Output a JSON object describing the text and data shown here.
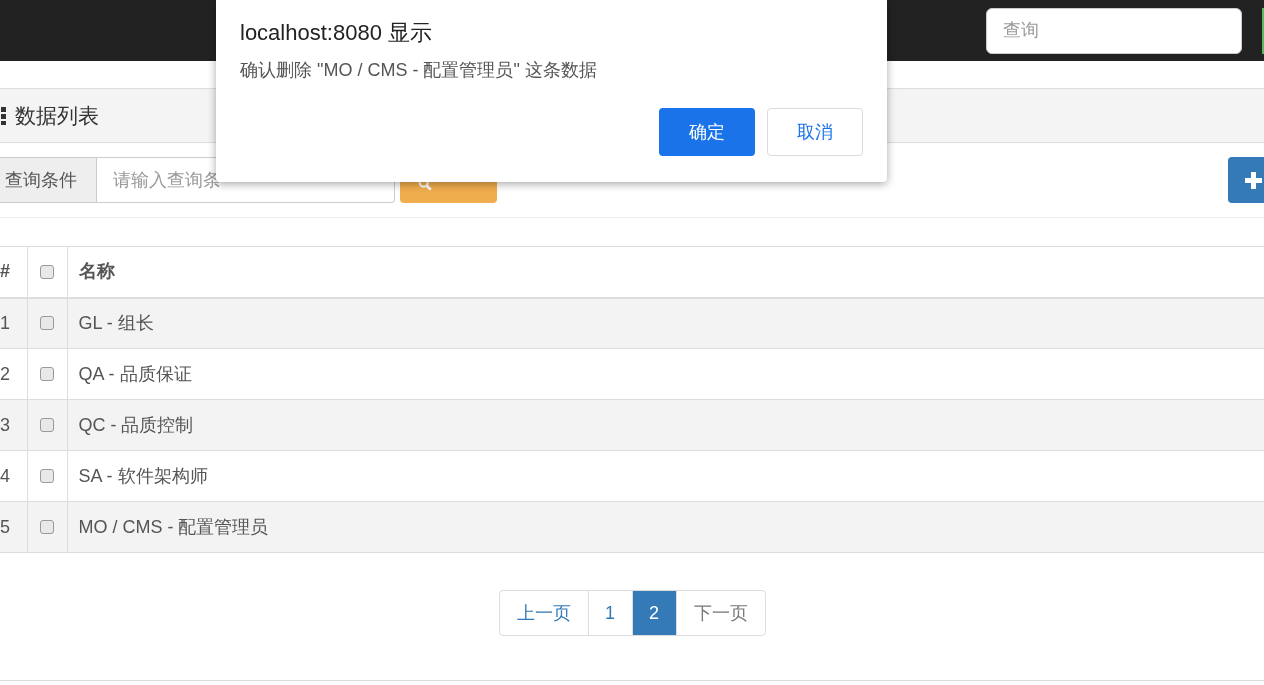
{
  "navbar": {
    "search_placeholder": "查询"
  },
  "panel": {
    "title": "数据列表"
  },
  "query": {
    "label": "查询条件",
    "placeholder": "请输入查询条"
  },
  "table": {
    "columns": [
      "#",
      "名称"
    ],
    "header_checked": false,
    "rows": [
      {
        "index": "1",
        "name": "GL - 组长",
        "checked": false
      },
      {
        "index": "2",
        "name": "QA - 品质保证",
        "checked": false
      },
      {
        "index": "3",
        "name": "QC - 品质控制",
        "checked": false
      },
      {
        "index": "4",
        "name": "SA - 软件架构师",
        "checked": false
      },
      {
        "index": "5",
        "name": "MO / CMS - 配置管理员",
        "checked": false
      }
    ]
  },
  "pagination": [
    {
      "label": "上一页",
      "kind": "nav",
      "selected": false
    },
    {
      "label": "1",
      "kind": "page",
      "selected": false
    },
    {
      "label": "2",
      "kind": "page",
      "selected": true
    },
    {
      "label": "下一页",
      "kind": "nav",
      "selected": false
    }
  ],
  "dialog": {
    "title": "localhost:8080 显示",
    "message": "确认删除 \"MO / CMS - 配置管理员\" 这条数据",
    "buttons": [
      {
        "label": "确定",
        "kind": "primary"
      },
      {
        "label": "取消",
        "kind": "secondary"
      }
    ]
  }
}
